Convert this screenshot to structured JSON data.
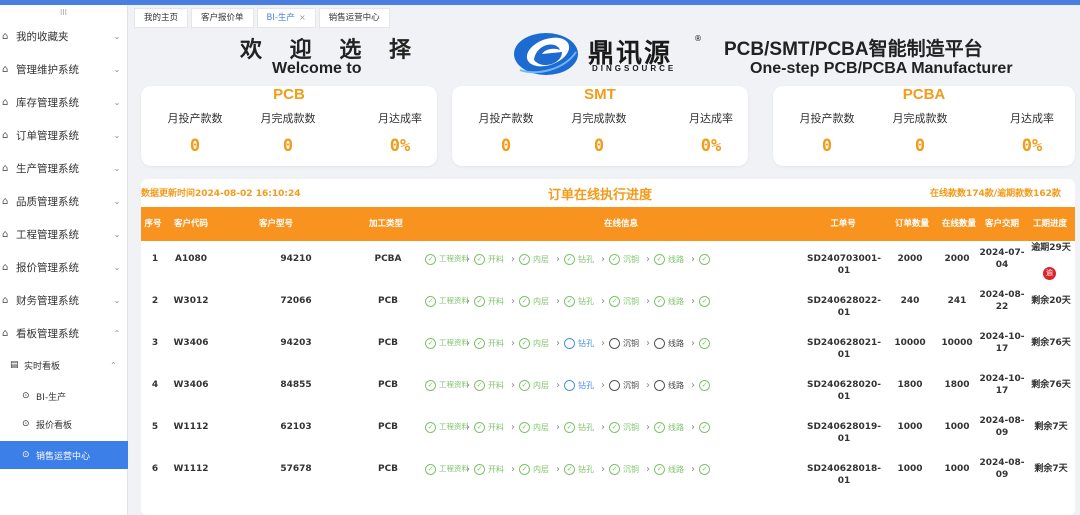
{
  "sidebar": {
    "grip": "III",
    "items": [
      {
        "label": "我的收藏夹"
      },
      {
        "label": "管理维护系统"
      },
      {
        "label": "库存管理系统"
      },
      {
        "label": "订单管理系统"
      },
      {
        "label": "生产管理系统"
      },
      {
        "label": "品质管理系统"
      },
      {
        "label": "工程管理系统"
      },
      {
        "label": "报价管理系统"
      },
      {
        "label": "财务管理系统"
      },
      {
        "label": "看板管理系统"
      }
    ],
    "sub": {
      "label": "实时看板"
    },
    "sub_items": [
      {
        "label": "BI-生产"
      },
      {
        "label": "报价看板"
      },
      {
        "label": "销售运营中心"
      }
    ]
  },
  "tabs": [
    {
      "label": "我的主页"
    },
    {
      "label": "客户报价单"
    },
    {
      "label": "BI-生产"
    },
    {
      "label": "销售运营中心"
    }
  ],
  "header": {
    "welcome_cn": "欢 迎 选 择",
    "welcome_en": "Welcome to",
    "logo_cn": "鼎讯源",
    "logo_en": "DINGSOURCE",
    "logo_mark": "®",
    "platform_cn": "PCB/SMT/PCBA智能制造平台",
    "platform_en": "One-step PCB/PCBA Manufacturer"
  },
  "cards": [
    {
      "title": "PCB",
      "stats": [
        {
          "label": "月投产款数",
          "value": "0"
        },
        {
          "label": "月完成款数",
          "value": "0"
        },
        {
          "label": "月达成率",
          "value": "0%"
        }
      ]
    },
    {
      "title": "SMT",
      "stats": [
        {
          "label": "月投产款数",
          "value": "0"
        },
        {
          "label": "月完成款数",
          "value": "0"
        },
        {
          "label": "月达成率",
          "value": "0%"
        }
      ]
    },
    {
      "title": "PCBA",
      "stats": [
        {
          "label": "月投产款数",
          "value": "0"
        },
        {
          "label": "月完成款数",
          "value": "0"
        },
        {
          "label": "月达成率",
          "value": "0%"
        }
      ]
    }
  ],
  "orders": {
    "update_time": "数据更新时间2024-08-02 16:10:24",
    "title": "订单在线执行进度",
    "counts": "在线款数174款/逾期款数162款",
    "columns": [
      "序号",
      "客户代码",
      "客户型号",
      "加工类型",
      "在线信息",
      "工单号",
      "订单数量",
      "在线数量",
      "客户交期",
      "工期进度"
    ],
    "rows": [
      {
        "no": "1",
        "customer": "A1080",
        "model": "94210",
        "type": "PCBA",
        "steps": [
          {
            "label": "工程资料",
            "state": "done"
          },
          {
            "label": "开料",
            "state": "done"
          },
          {
            "label": "内层",
            "state": "done"
          },
          {
            "label": "钻孔",
            "state": "done"
          },
          {
            "label": "沉铜",
            "state": "done"
          },
          {
            "label": "线路",
            "state": "done"
          }
        ],
        "work_order": "SD240703001-01",
        "qty": "2000",
        "online": "2000",
        "due": "2024-07-04",
        "progress": "逾期29天",
        "overdue_badge": "逾"
      },
      {
        "no": "2",
        "customer": "W3012",
        "model": "72066",
        "type": "PCB",
        "steps": [
          {
            "label": "工程资料",
            "state": "done"
          },
          {
            "label": "开料",
            "state": "done"
          },
          {
            "label": "内层",
            "state": "done"
          },
          {
            "label": "钻孔",
            "state": "done"
          },
          {
            "label": "沉铜",
            "state": "done"
          },
          {
            "label": "线路",
            "state": "done"
          }
        ],
        "work_order": "SD240628022-01",
        "qty": "240",
        "online": "241",
        "due": "2024-08-22",
        "progress": "剩余20天"
      },
      {
        "no": "3",
        "customer": "W3406",
        "model": "94203",
        "type": "PCB",
        "steps": [
          {
            "label": "工程资料",
            "state": "done"
          },
          {
            "label": "开料",
            "state": "done"
          },
          {
            "label": "内层",
            "state": "done"
          },
          {
            "label": "钻孔",
            "state": "cur"
          },
          {
            "label": "沉铜",
            "state": "todo"
          },
          {
            "label": "线路",
            "state": "todo"
          }
        ],
        "work_order": "SD240628021-01",
        "qty": "10000",
        "online": "10000",
        "due": "2024-10-17",
        "progress": "剩余76天"
      },
      {
        "no": "4",
        "customer": "W3406",
        "model": "84855",
        "type": "PCB",
        "steps": [
          {
            "label": "工程资料",
            "state": "done"
          },
          {
            "label": "开料",
            "state": "done"
          },
          {
            "label": "内层",
            "state": "done"
          },
          {
            "label": "钻孔",
            "state": "cur"
          },
          {
            "label": "沉铜",
            "state": "todo"
          },
          {
            "label": "线路",
            "state": "todo"
          }
        ],
        "work_order": "SD240628020-01",
        "qty": "1800",
        "online": "1800",
        "due": "2024-10-17",
        "progress": "剩余76天"
      },
      {
        "no": "5",
        "customer": "W1112",
        "model": "62103",
        "type": "PCB",
        "steps": [
          {
            "label": "工程资料",
            "state": "done"
          },
          {
            "label": "开料",
            "state": "done"
          },
          {
            "label": "内层",
            "state": "done"
          },
          {
            "label": "钻孔",
            "state": "done"
          },
          {
            "label": "沉铜",
            "state": "done"
          },
          {
            "label": "线路",
            "state": "done"
          }
        ],
        "work_order": "SD240628019-01",
        "qty": "1000",
        "online": "1000",
        "due": "2024-08-09",
        "progress": "剩余7天"
      },
      {
        "no": "6",
        "customer": "W1112",
        "model": "57678",
        "type": "PCB",
        "steps": [
          {
            "label": "工程资料",
            "state": "done"
          },
          {
            "label": "开料",
            "state": "done"
          },
          {
            "label": "内层",
            "state": "done"
          },
          {
            "label": "钻孔",
            "state": "done"
          },
          {
            "label": "沉铜",
            "state": "done"
          },
          {
            "label": "线路",
            "state": "done"
          }
        ],
        "work_order": "SD240628018-01",
        "qty": "1000",
        "online": "1000",
        "due": "2024-08-09",
        "progress": "剩余7天"
      }
    ]
  }
}
